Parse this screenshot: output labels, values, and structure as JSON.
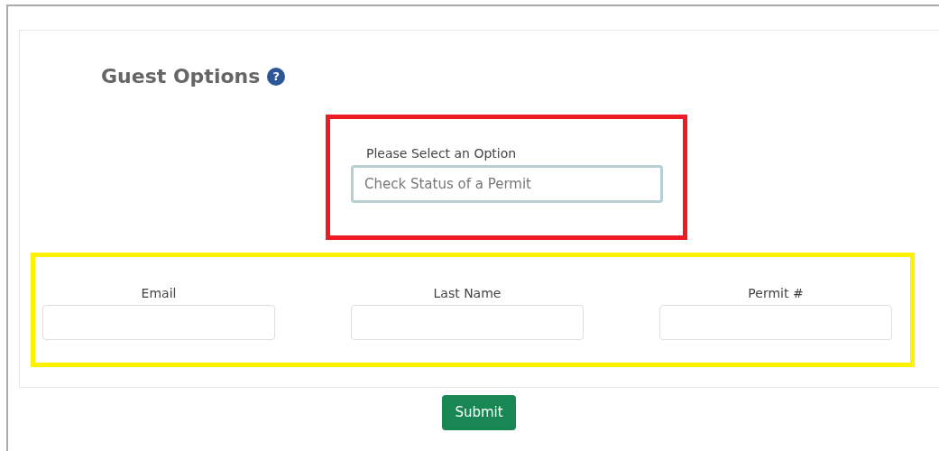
{
  "title": "Guest Options",
  "help_icon": "?",
  "highlights": [
    {
      "color": "#ed1c24"
    },
    {
      "color": "#fff200"
    }
  ],
  "option_select": {
    "label": "Please Select an Option",
    "value": "Check Status of a Permit"
  },
  "fields": [
    {
      "label": "Email"
    },
    {
      "label": "Last Name"
    },
    {
      "label": "Permit #"
    }
  ],
  "submit_button": "Submit"
}
